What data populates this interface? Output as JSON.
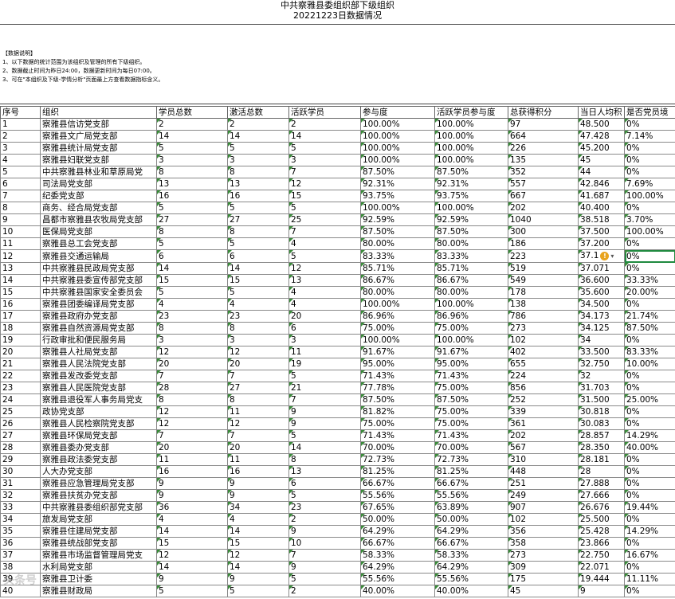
{
  "title": "中共察雅县委组织部下级组织",
  "subtitle": "20221223日数据情况",
  "notes": [
    "【数据说明】",
    "1、以下数据的统计范围为该组织及管理的所有下级组织。",
    "2、数据截止时间为昨日24:00，数据更新时间为每日07:00。",
    "3、可在\"本组织及下级-学情分析\"页面最上方查看数据指标含义。"
  ],
  "columns": [
    "序号",
    "组织",
    "学员总数",
    "激活总数",
    "活跃学员",
    "参与度",
    "活跃学员参与度",
    "总获得积分",
    "当日人均积",
    "是否党员境"
  ],
  "warning_symbol": "!",
  "dropdown_symbol": "▾",
  "watermark": "头条号",
  "rows": [
    [
      "1",
      "察雅县信访党支部",
      "2",
      "2",
      "2",
      "100.00%",
      "100.00%",
      "97",
      "48.500",
      "0%"
    ],
    [
      "2",
      "察雅县文广局党支部",
      "14",
      "14",
      "14",
      "100.00%",
      "100.00%",
      "664",
      "47.428",
      "7.14%"
    ],
    [
      "3",
      "察雅县统计局党支部",
      "5",
      "5",
      "5",
      "100.00%",
      "100.00%",
      "226",
      "45.200",
      "0%"
    ],
    [
      "4",
      "察雅县妇联党支部",
      "3",
      "3",
      "3",
      "100.00%",
      "100.00%",
      "135",
      "45",
      "0%"
    ],
    [
      "5",
      "中共察雅县林业和草原局党",
      "8",
      "8",
      "7",
      "87.50%",
      "87.50%",
      "352",
      "44",
      "0%"
    ],
    [
      "6",
      "司法局党支部",
      "13",
      "13",
      "12",
      "92.31%",
      "92.31%",
      "557",
      "42.846",
      "7.69%"
    ],
    [
      "7",
      "纪委党支部",
      "16",
      "16",
      "15",
      "93.75%",
      "93.75%",
      "667",
      "41.687",
      "100.00%"
    ],
    [
      "8",
      "商务、经合局党支部",
      "5",
      "5",
      "5",
      "100.00%",
      "100.00%",
      "202",
      "40.400",
      "0%"
    ],
    [
      "9",
      "昌都市察雅县农牧局党支部",
      "27",
      "27",
      "25",
      "92.59%",
      "92.59%",
      "1040",
      "38.518",
      "3.70%"
    ],
    [
      "10",
      "医保局党支部",
      "8",
      "8",
      "7",
      "87.50%",
      "87.50%",
      "300",
      "37.500",
      "100.00%"
    ],
    [
      "11",
      "察雅县总工会党支部",
      "5",
      "5",
      "4",
      "80.00%",
      "80.00%",
      "186",
      "37.200",
      "0%"
    ],
    [
      "12",
      "察雅县交通运输局",
      "6",
      "6",
      "5",
      "83.33%",
      "83.33%",
      "223",
      "37.1",
      "0%"
    ],
    [
      "13",
      "中共察雅县民政局党支部",
      "14",
      "14",
      "12",
      "85.71%",
      "85.71%",
      "519",
      "37.071",
      "0%"
    ],
    [
      "14",
      "中共察雅县委宣传部党支部",
      "15",
      "15",
      "13",
      "86.67%",
      "86.67%",
      "549",
      "36.600",
      "33.33%"
    ],
    [
      "15",
      "中共察雅县国家安全委员会",
      "5",
      "5",
      "4",
      "80.00%",
      "80.00%",
      "178",
      "35.600",
      "20.00%"
    ],
    [
      "16",
      "察雅县团委编译局党支部",
      "4",
      "4",
      "4",
      "100.00%",
      "100.00%",
      "138",
      "34.500",
      "0%"
    ],
    [
      "17",
      "察雅县政府办党支部",
      "23",
      "23",
      "20",
      "86.96%",
      "86.96%",
      "786",
      "34.173",
      "21.74%"
    ],
    [
      "18",
      "察雅县自然资源局党支部",
      "8",
      "8",
      "6",
      "75.00%",
      "75.00%",
      "273",
      "34.125",
      "87.50%"
    ],
    [
      "19",
      "行政审批和便民服务局",
      "3",
      "3",
      "3",
      "100.00%",
      "100.00%",
      "102",
      "34",
      "0%"
    ],
    [
      "20",
      "察雅县人社局党支部",
      "12",
      "12",
      "11",
      "91.67%",
      "91.67%",
      "402",
      "33.500",
      "83.33%"
    ],
    [
      "21",
      "察雅县人民法院党支部",
      "20",
      "20",
      "19",
      "95.00%",
      "95.00%",
      "655",
      "32.750",
      "10.00%"
    ],
    [
      "22",
      "察雅县发改委党支部",
      "7",
      "7",
      "5",
      "71.43%",
      "71.43%",
      "224",
      "32",
      "0%"
    ],
    [
      "23",
      "察雅县人民医院党支部",
      "28",
      "27",
      "21",
      "77.78%",
      "75.00%",
      "856",
      "31.703",
      "0%"
    ],
    [
      "24",
      "察雅县退役军人事务局党支",
      "8",
      "8",
      "7",
      "87.50%",
      "87.50%",
      "252",
      "31.500",
      "25.00%"
    ],
    [
      "25",
      "政协党支部",
      "12",
      "11",
      "9",
      "81.82%",
      "75.00%",
      "339",
      "30.818",
      "0%"
    ],
    [
      "26",
      "察雅县人民检察院党支部",
      "12",
      "12",
      "9",
      "75.00%",
      "75.00%",
      "361",
      "30.083",
      "0%"
    ],
    [
      "27",
      "察雅县环保局党支部",
      "7",
      "7",
      "5",
      "71.43%",
      "71.43%",
      "202",
      "28.857",
      "14.29%"
    ],
    [
      "28",
      "察雅县委办党支部",
      "20",
      "20",
      "14",
      "70.00%",
      "70.00%",
      "567",
      "28.350",
      "40.00%"
    ],
    [
      "29",
      "察雅县政法委党支部",
      "11",
      "11",
      "8",
      "72.73%",
      "72.73%",
      "310",
      "28.181",
      "0%"
    ],
    [
      "30",
      "人大办党支部",
      "16",
      "16",
      "13",
      "81.25%",
      "81.25%",
      "448",
      "28",
      "0%"
    ],
    [
      "31",
      "察雅县应急管理局党支部",
      "9",
      "9",
      "6",
      "66.67%",
      "66.67%",
      "251",
      "27.888",
      "0%"
    ],
    [
      "32",
      "察雅县扶贫办党支部",
      "9",
      "9",
      "5",
      "55.56%",
      "55.56%",
      "249",
      "27.666",
      "0%"
    ],
    [
      "33",
      "中共察雅县委组织部党支部",
      "36",
      "34",
      "23",
      "67.65%",
      "63.89%",
      "907",
      "26.676",
      "19.44%"
    ],
    [
      "34",
      "旅发局党支部",
      "4",
      "4",
      "2",
      "50.00%",
      "50.00%",
      "102",
      "25.500",
      "0%"
    ],
    [
      "35",
      "察雅县住建局党支部",
      "14",
      "14",
      "9",
      "64.29%",
      "64.29%",
      "356",
      "25.428",
      "14.29%"
    ],
    [
      "36",
      "察雅县统战部党支部",
      "15",
      "15",
      "10",
      "66.67%",
      "66.67%",
      "358",
      "23.866",
      "0%"
    ],
    [
      "37",
      "察雅县市场监督管理局党支",
      "12",
      "12",
      "7",
      "58.33%",
      "58.33%",
      "273",
      "22.750",
      "16.67%"
    ],
    [
      "38",
      "水利局党支部",
      "14",
      "14",
      "9",
      "64.29%",
      "64.29%",
      "309",
      "22.071",
      "0%"
    ],
    [
      "39",
      "察雅县卫计委",
      "9",
      "9",
      "5",
      "55.56%",
      "55.56%",
      "175",
      "19.444",
      "11.11%"
    ],
    [
      "40",
      "察雅县财政局",
      "5",
      "5",
      "2",
      "40.00%",
      "40.00%",
      "45",
      "9",
      "0%"
    ]
  ]
}
